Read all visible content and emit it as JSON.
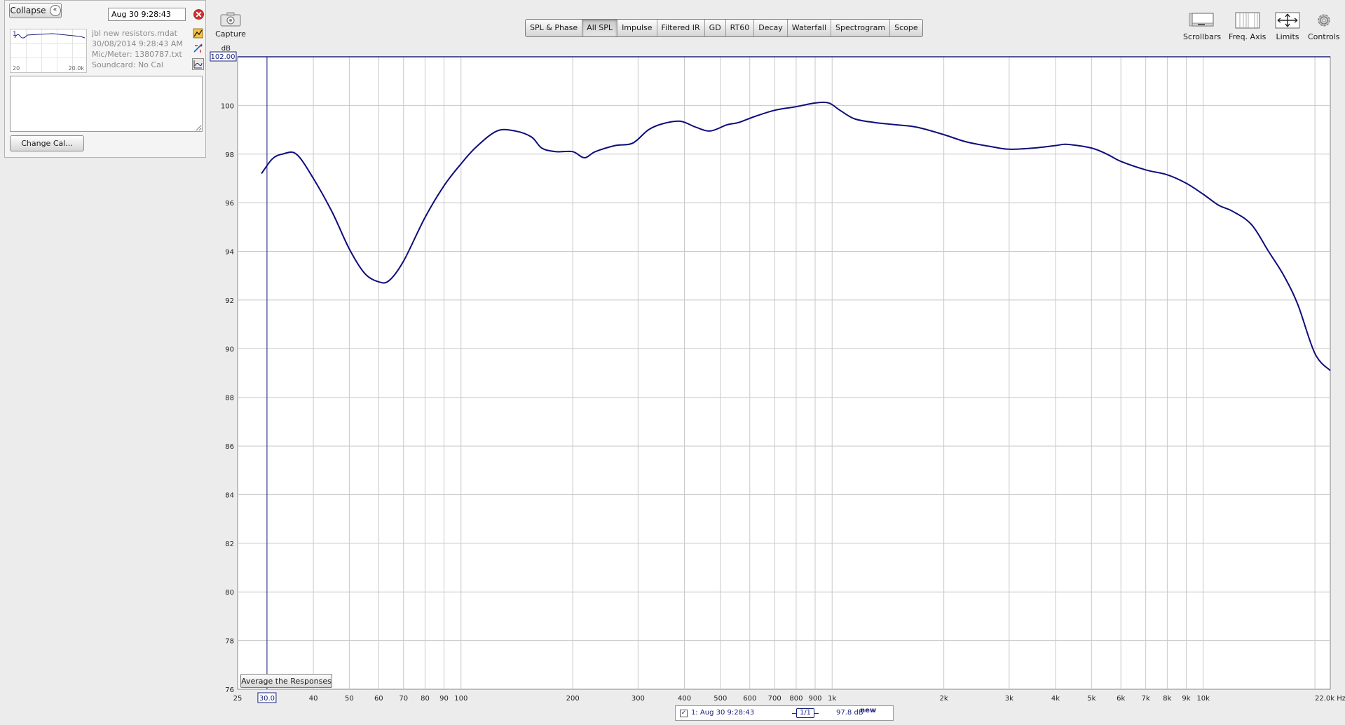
{
  "left_panel": {
    "collapse_label": "Collapse",
    "measurement_name": "Aug 30 9:28:43",
    "info": {
      "file": "jbl new resistors.mdat",
      "datetime": "30/08/2014 9:28:43 AM",
      "mic_meter": "Mic/Meter: 1380787.txt",
      "soundcard": "Soundcard: No Cal"
    },
    "thumbnail": {
      "index": "1",
      "x_min": "20",
      "x_max": "20.0k"
    },
    "notes": "",
    "change_cal_label": "Change Cal..."
  },
  "capture_label": "Capture",
  "tabs": [
    {
      "label": "SPL & Phase",
      "active": false
    },
    {
      "label": "All SPL",
      "active": true
    },
    {
      "label": "Impulse",
      "active": false
    },
    {
      "label": "Filtered IR",
      "active": false
    },
    {
      "label": "GD",
      "active": false
    },
    {
      "label": "RT60",
      "active": false
    },
    {
      "label": "Decay",
      "active": false
    },
    {
      "label": "Waterfall",
      "active": false
    },
    {
      "label": "Spectrogram",
      "active": false
    },
    {
      "label": "Scope",
      "active": false
    }
  ],
  "toolbar": {
    "scrollbars": "Scrollbars",
    "freq_axis": "Freq. Axis",
    "limits": "Limits",
    "controls": "Controls"
  },
  "average_label": "Average the Responses",
  "legend": {
    "checked": true,
    "name": "1: Aug 30 9:28:43",
    "smoothing": "1/1",
    "value": "97.8 dB",
    "tag": "new"
  },
  "colors": {
    "trace": "#0d0d7a",
    "grid": "#c8c8c8",
    "panel": "#ececec"
  },
  "chart_data": {
    "type": "line",
    "xscale": "log",
    "xlim": [
      25,
      22000
    ],
    "ylim": [
      76,
      102
    ],
    "y_unit": "dB",
    "x_unit": "Hz",
    "top_readout": "102.00",
    "cursor_readout": "30.0",
    "y_ticks": [
      76,
      78,
      80,
      82,
      84,
      86,
      88,
      90,
      92,
      94,
      96,
      98,
      100
    ],
    "x_tick_labels": [
      {
        "v": 25,
        "t": "25"
      },
      {
        "v": 30,
        "t": "30.0"
      },
      {
        "v": 40,
        "t": "40"
      },
      {
        "v": 50,
        "t": "50"
      },
      {
        "v": 60,
        "t": "60"
      },
      {
        "v": 70,
        "t": "70"
      },
      {
        "v": 80,
        "t": "80"
      },
      {
        "v": 90,
        "t": "90"
      },
      {
        "v": 100,
        "t": "100"
      },
      {
        "v": 200,
        "t": "200"
      },
      {
        "v": 300,
        "t": "300"
      },
      {
        "v": 400,
        "t": "400"
      },
      {
        "v": 500,
        "t": "500"
      },
      {
        "v": 600,
        "t": "600"
      },
      {
        "v": 700,
        "t": "700"
      },
      {
        "v": 800,
        "t": "800"
      },
      {
        "v": 900,
        "t": "900"
      },
      {
        "v": 1000,
        "t": "1k"
      },
      {
        "v": 2000,
        "t": "2k"
      },
      {
        "v": 3000,
        "t": "3k"
      },
      {
        "v": 4000,
        "t": "4k"
      },
      {
        "v": 5000,
        "t": "5k"
      },
      {
        "v": 6000,
        "t": "6k"
      },
      {
        "v": 7000,
        "t": "7k"
      },
      {
        "v": 8000,
        "t": "8k"
      },
      {
        "v": 9000,
        "t": "9k"
      },
      {
        "v": 10000,
        "t": "10k"
      },
      {
        "v": 22000,
        "t": "22.0k Hz"
      }
    ],
    "series": [
      {
        "x": [
          29,
          31,
          33,
          36,
          40,
          45,
          50,
          55,
          60,
          64,
          70,
          80,
          90,
          100,
          110,
          125,
          140,
          155,
          165,
          180,
          200,
          215,
          230,
          260,
          290,
          320,
          350,
          390,
          430,
          470,
          520,
          560,
          620,
          700,
          800,
          900,
          980,
          1050,
          1150,
          1300,
          1500,
          1700,
          2000,
          2300,
          2700,
          3000,
          3500,
          4000,
          4300,
          5000,
          5500,
          6000,
          7000,
          8000,
          9000,
          10000,
          11000,
          12000,
          13500,
          15000,
          16500,
          18000,
          20000,
          22000
        ],
        "y": [
          97.2,
          97.8,
          98.0,
          98.0,
          97.0,
          95.6,
          94.1,
          93.1,
          92.75,
          92.8,
          93.6,
          95.4,
          96.7,
          97.6,
          98.3,
          98.95,
          98.95,
          98.7,
          98.25,
          98.1,
          98.1,
          97.85,
          98.1,
          98.35,
          98.45,
          99.0,
          99.25,
          99.35,
          99.1,
          98.95,
          99.2,
          99.3,
          99.55,
          99.8,
          99.95,
          100.1,
          100.1,
          99.8,
          99.45,
          99.3,
          99.2,
          99.1,
          98.8,
          98.5,
          98.3,
          98.2,
          98.25,
          98.35,
          98.4,
          98.25,
          98.0,
          97.7,
          97.35,
          97.15,
          96.8,
          96.35,
          95.9,
          95.65,
          95.1,
          94.0,
          93.0,
          91.8,
          89.8,
          89.1
        ]
      }
    ]
  }
}
